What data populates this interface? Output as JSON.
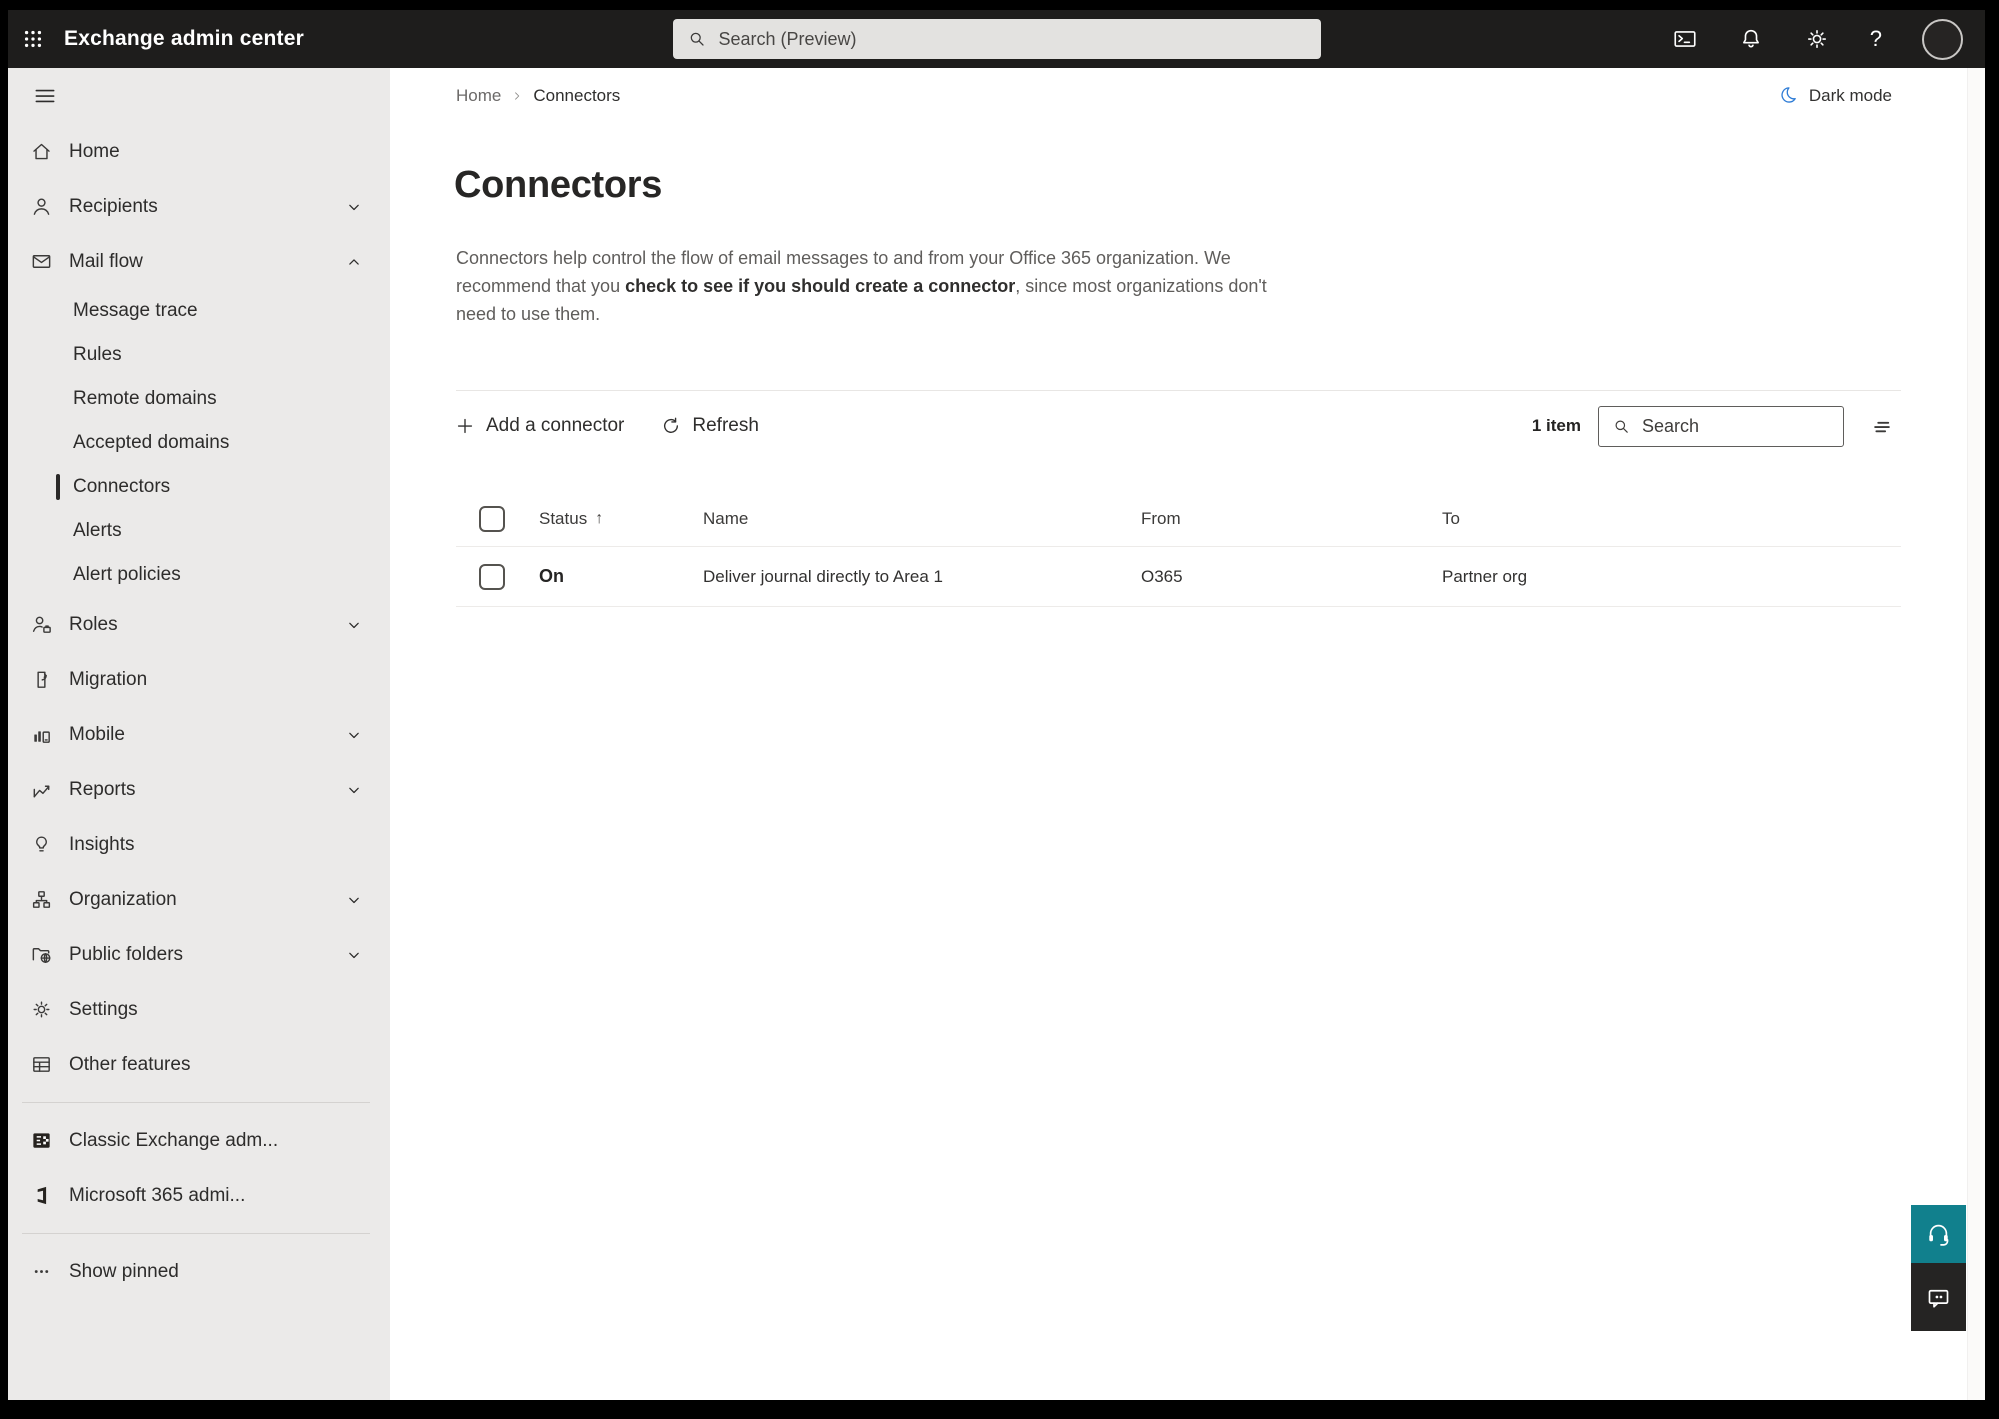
{
  "topbar": {
    "title": "Exchange admin center",
    "search_placeholder": "Search (Preview)",
    "actions": [
      {
        "name": "terminal-icon"
      },
      {
        "name": "bell-icon"
      },
      {
        "name": "gear-icon"
      }
    ],
    "help_label": "?"
  },
  "sidebar": {
    "items": [
      {
        "label": "Home",
        "icon": "home-icon",
        "indent": false,
        "chevron": null,
        "selected": false
      },
      {
        "label": "Recipients",
        "icon": "person-icon",
        "indent": false,
        "chevron": "down",
        "selected": false
      },
      {
        "label": "Mail flow",
        "icon": "mail-icon",
        "indent": false,
        "chevron": "up",
        "selected": false
      },
      {
        "label": "Message trace",
        "icon": null,
        "indent": true,
        "chevron": null,
        "selected": false
      },
      {
        "label": "Rules",
        "icon": null,
        "indent": true,
        "chevron": null,
        "selected": false
      },
      {
        "label": "Remote domains",
        "icon": null,
        "indent": true,
        "chevron": null,
        "selected": false
      },
      {
        "label": "Accepted domains",
        "icon": null,
        "indent": true,
        "chevron": null,
        "selected": false
      },
      {
        "label": "Connectors",
        "icon": null,
        "indent": true,
        "chevron": null,
        "selected": true
      },
      {
        "label": "Alerts",
        "icon": null,
        "indent": true,
        "chevron": null,
        "selected": false
      },
      {
        "label": "Alert policies",
        "icon": null,
        "indent": true,
        "chevron": null,
        "selected": false
      },
      {
        "label": "Roles",
        "icon": "roles-icon",
        "indent": false,
        "chevron": "down",
        "selected": false
      },
      {
        "label": "Migration",
        "icon": "migration-icon",
        "indent": false,
        "chevron": null,
        "selected": false
      },
      {
        "label": "Mobile",
        "icon": "mobile-icon",
        "indent": false,
        "chevron": "down",
        "selected": false
      },
      {
        "label": "Reports",
        "icon": "reports-icon",
        "indent": false,
        "chevron": "down",
        "selected": false
      },
      {
        "label": "Insights",
        "icon": "insights-icon",
        "indent": false,
        "chevron": null,
        "selected": false
      },
      {
        "label": "Organization",
        "icon": "organization-icon",
        "indent": false,
        "chevron": "down",
        "selected": false
      },
      {
        "label": "Public folders",
        "icon": "public-folders-icon",
        "indent": false,
        "chevron": "down",
        "selected": false
      },
      {
        "label": "Settings",
        "icon": "gear-icon",
        "indent": false,
        "chevron": null,
        "selected": false
      },
      {
        "label": "Other features",
        "icon": "table-icon",
        "indent": false,
        "chevron": null,
        "selected": false
      },
      {
        "label": "Classic Exchange adm...",
        "icon": "exchange-logo-icon",
        "indent": false,
        "chevron": null,
        "selected": false,
        "divider_before": true
      },
      {
        "label": "Microsoft 365 admi...",
        "icon": "m365-logo-icon",
        "indent": false,
        "chevron": null,
        "selected": false
      },
      {
        "label": "Show pinned",
        "icon": "ellipsis-icon",
        "indent": false,
        "chevron": null,
        "selected": false,
        "divider_before": true
      }
    ]
  },
  "breadcrumb": {
    "home": "Home",
    "current": "Connectors"
  },
  "darkmode": {
    "label": "Dark mode"
  },
  "page": {
    "title": "Connectors",
    "description_before": "Connectors help control the flow of email messages to and from your Office 365 organization. We recommend that you ",
    "description_link": "check to see if you should create a connector",
    "description_after": ", since most organizations don't need to use them."
  },
  "toolbar": {
    "add_label": "Add a connector",
    "refresh_label": "Refresh",
    "count": "1 item",
    "search_placeholder": "Search"
  },
  "table": {
    "headers": {
      "status": "Status",
      "name": "Name",
      "from": "From",
      "to": "To"
    },
    "sort": {
      "column": "status",
      "direction": "asc",
      "glyph": "↑"
    },
    "rows": [
      {
        "status": "On",
        "name": "Deliver journal directly to Area 1",
        "from": "O365",
        "to": "Partner org"
      }
    ]
  },
  "icons": {
    "registry": [
      "waffle-icon",
      "search-icon",
      "terminal-icon",
      "bell-icon",
      "gear-icon",
      "help-icon",
      "avatar",
      "hamburger-icon",
      "home-icon",
      "person-icon",
      "mail-icon",
      "roles-icon",
      "migration-icon",
      "mobile-icon",
      "reports-icon",
      "insights-icon",
      "organization-icon",
      "public-folders-icon",
      "table-icon",
      "exchange-logo-icon",
      "m365-logo-icon",
      "ellipsis-icon",
      "chevron-down-icon",
      "chevron-up-icon",
      "chevron-right-icon",
      "moon-icon",
      "plus-icon",
      "refresh-icon",
      "filter-icon",
      "headset-icon",
      "chat-icon"
    ]
  },
  "colors": {
    "topbar_bg": "#1e1d1c",
    "sidebar_bg": "#ebeae9",
    "teal_button": "#11808d",
    "dark_button": "#252423",
    "moon_blue": "#2e7cd6"
  }
}
